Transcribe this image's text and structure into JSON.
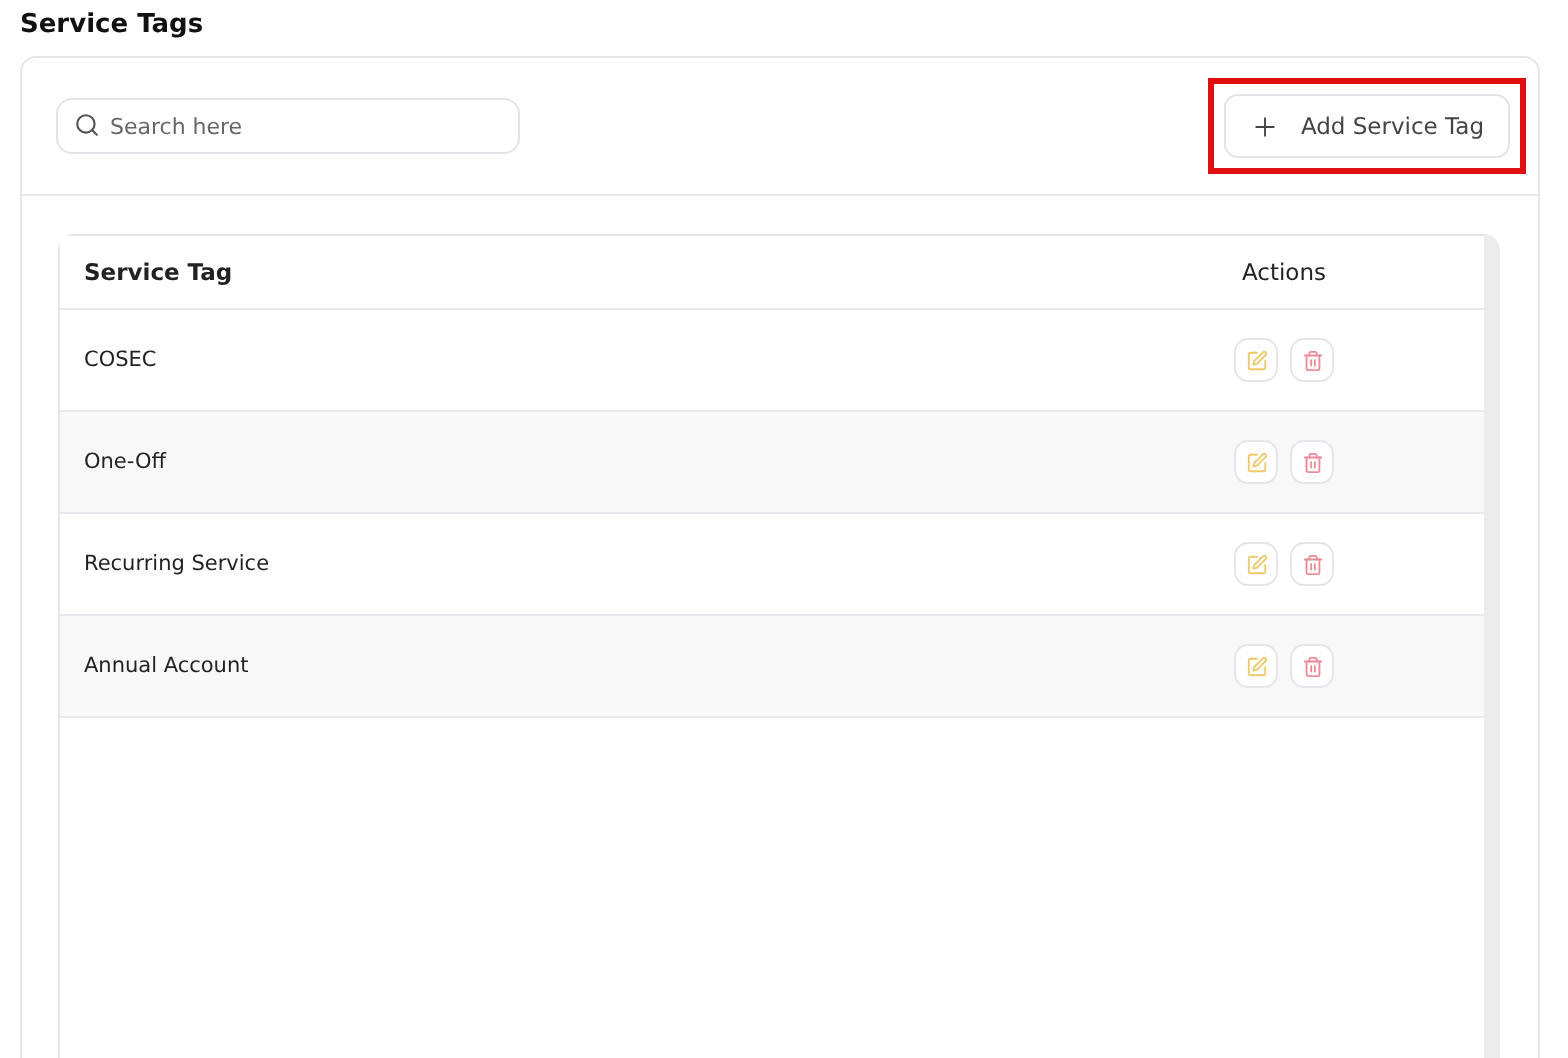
{
  "page_title": "Service Tags",
  "search": {
    "placeholder": "Search here"
  },
  "add_button": {
    "label": "Add Service Tag",
    "highlighted": true
  },
  "table": {
    "columns": [
      "Service Tag",
      "Actions"
    ],
    "rows": [
      {
        "name": "COSEC"
      },
      {
        "name": "One-Off"
      },
      {
        "name": "Recurring Service"
      },
      {
        "name": "Annual Account"
      }
    ]
  }
}
